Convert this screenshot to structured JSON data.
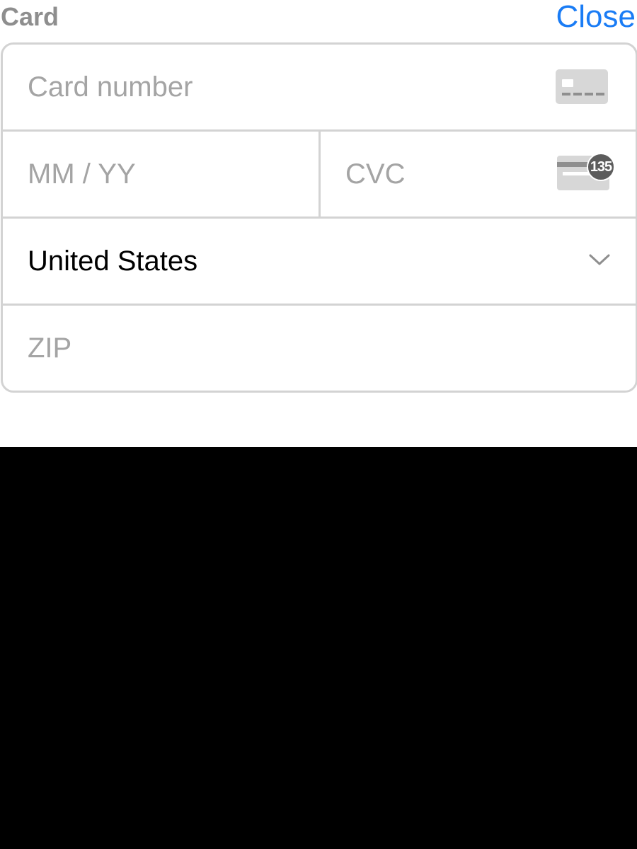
{
  "header": {
    "title": "Card",
    "close_label": "Close"
  },
  "form": {
    "card_number": {
      "placeholder": "Card number",
      "value": "",
      "icon": "credit-card-icon"
    },
    "expiry": {
      "placeholder": "MM / YY",
      "value": ""
    },
    "cvc": {
      "placeholder": "CVC",
      "value": "",
      "icon": "cvc-card-icon",
      "icon_badge": "135"
    },
    "country": {
      "value": "United States",
      "icon": "chevron-down-icon"
    },
    "zip": {
      "placeholder": "ZIP",
      "value": ""
    }
  },
  "colors": {
    "accent": "#1a7cf5",
    "placeholder": "#a4a4a4",
    "border": "#d3d3d3",
    "title": "#8e8e8e",
    "backdrop": "#000000"
  }
}
